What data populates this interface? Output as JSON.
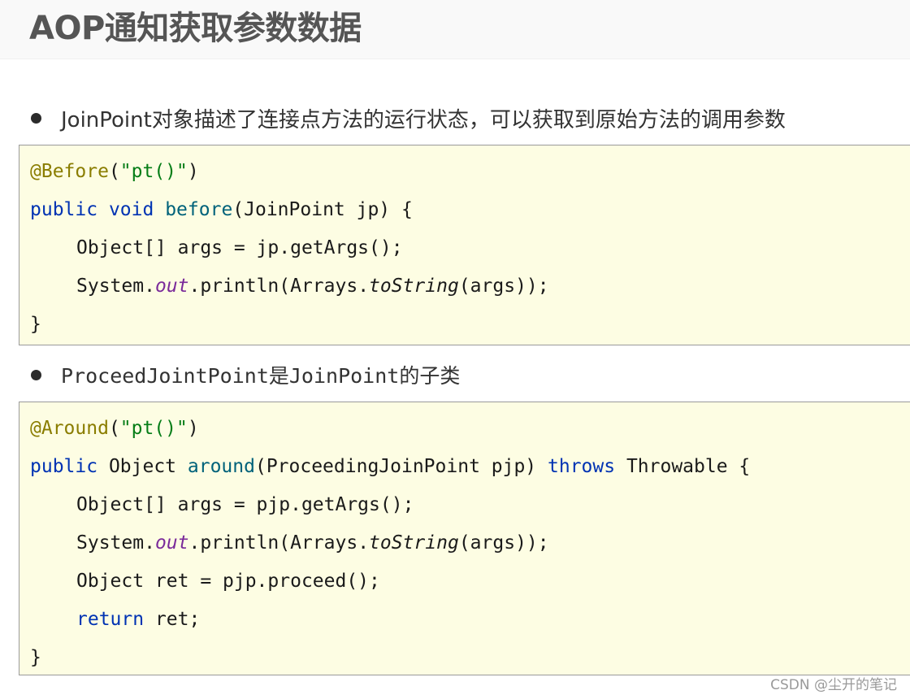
{
  "title": "AOP通知获取参数数据",
  "bullets": [
    "JoinPoint对象描述了连接点方法的运行状态，可以获取到原始方法的调用参数",
    "ProceedJointPoint是JoinPoint的子类"
  ],
  "code_blocks": [
    {
      "lines": [
        {
          "parts": [
            [
              "@Before",
              "ann"
            ],
            [
              "(",
              ""
            ],
            [
              "\"pt()\"",
              "str"
            ],
            [
              ")",
              ""
            ]
          ]
        },
        {
          "parts": [
            [
              "public",
              "kw"
            ],
            [
              " ",
              ""
            ],
            [
              "void",
              "kw"
            ],
            [
              " ",
              ""
            ],
            [
              "before",
              "fn"
            ],
            [
              "(JoinPoint jp) {",
              ""
            ]
          ]
        },
        {
          "indent": true,
          "parts": [
            [
              "Object[] args = jp.getArgs();",
              ""
            ]
          ]
        },
        {
          "indent": true,
          "parts": [
            [
              "System.",
              ""
            ],
            [
              "out",
              "field"
            ],
            [
              ".println(Arrays.",
              ""
            ],
            [
              "toString",
              "static"
            ],
            [
              "(args));",
              ""
            ]
          ]
        },
        {
          "parts": [
            [
              "}",
              ""
            ]
          ]
        }
      ]
    },
    {
      "lines": [
        {
          "parts": [
            [
              "@Around",
              "ann"
            ],
            [
              "(",
              ""
            ],
            [
              "\"pt()\"",
              "str"
            ],
            [
              ")",
              ""
            ]
          ]
        },
        {
          "parts": [
            [
              "public",
              "kw"
            ],
            [
              " Object ",
              ""
            ],
            [
              "around",
              "fn"
            ],
            [
              "(ProceedingJoinPoint pjp) ",
              ""
            ],
            [
              "throws",
              "kw"
            ],
            [
              " Throwable {",
              ""
            ]
          ]
        },
        {
          "indent": true,
          "parts": [
            [
              "Object[] args = pjp.getArgs();",
              ""
            ]
          ]
        },
        {
          "indent": true,
          "parts": [
            [
              "System.",
              ""
            ],
            [
              "out",
              "field"
            ],
            [
              ".println(Arrays.",
              ""
            ],
            [
              "toString",
              "static"
            ],
            [
              "(args));",
              ""
            ]
          ]
        },
        {
          "indent": true,
          "parts": [
            [
              "Object ret = pjp.proceed();",
              ""
            ]
          ]
        },
        {
          "indent": true,
          "parts": [
            [
              "return",
              "kw"
            ],
            [
              " ret;",
              ""
            ]
          ]
        },
        {
          "parts": [
            [
              "}",
              ""
            ]
          ]
        }
      ]
    }
  ],
  "watermark": "CSDN @尘开的笔记"
}
